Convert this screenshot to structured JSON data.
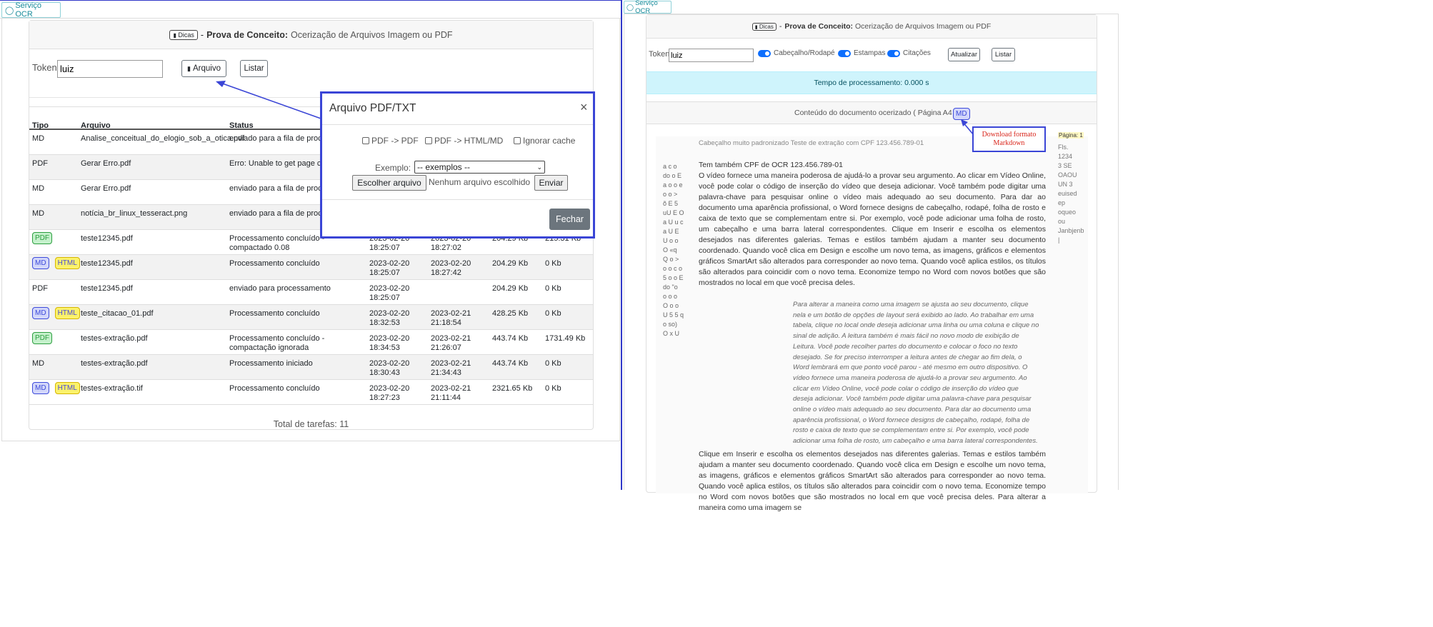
{
  "left": {
    "service_tab": "Serviço OCR",
    "header": {
      "dicas_label": "Dicas",
      "separator": "-",
      "title_bold": "Prova de Conceito:",
      "title_rest": "Ocerização de Arquivos Imagem ou PDF"
    },
    "token_label": "Token:",
    "token_value": "luiz",
    "arquivo_button": "Arquivo",
    "listar_button": "Listar",
    "table": {
      "headers": [
        "Tipo",
        "Arquivo",
        "Status"
      ],
      "rows": [
        {
          "badges": [],
          "tipo_text": "MD",
          "arquivo": "Analise_conceitual_do_elogio_sob_a_otica.pdf",
          "status": "enviado para a fila de processamento",
          "inicio": "",
          "fim": "",
          "tamanho": "",
          "saida": ""
        },
        {
          "badges": [],
          "tipo_text": "PDF",
          "arquivo": "Gerar Erro.pdf",
          "status": "Erro: Unable to get page count",
          "inicio": "",
          "fim": "",
          "tamanho": "",
          "saida": ""
        },
        {
          "badges": [],
          "tipo_text": "MD",
          "arquivo": "Gerar Erro.pdf",
          "status": "enviado para a fila de processamento",
          "inicio": "",
          "fim": "",
          "tamanho": "",
          "saida": ""
        },
        {
          "badges": [],
          "tipo_text": "MD",
          "arquivo": "notícia_br_linux_tesseract.png",
          "status": "enviado para a fila de processamento",
          "inicio": "",
          "fim": "",
          "tamanho": "",
          "saida": ""
        },
        {
          "badges": [
            "PDF"
          ],
          "tipo_text": "",
          "arquivo": "teste12345.pdf",
          "status": "Processamento concluído - compactado 0.08",
          "inicio": "2023-02-20 18:25:07",
          "fim": "2023-02-20 18:27:02",
          "tamanho": "204.29 Kb",
          "saida": "215.31 Kb"
        },
        {
          "badges": [
            "MD",
            "HTML"
          ],
          "tipo_text": "",
          "arquivo": "teste12345.pdf",
          "status": "Processamento concluído",
          "inicio": "2023-02-20 18:25:07",
          "fim": "2023-02-20 18:27:42",
          "tamanho": "204.29 Kb",
          "saida": "0 Kb"
        },
        {
          "badges": [],
          "tipo_text": "PDF",
          "arquivo": "teste12345.pdf",
          "status": "enviado para processamento",
          "inicio": "2023-02-20 18:25:07",
          "fim": "",
          "tamanho": "204.29 Kb",
          "saida": "0 Kb"
        },
        {
          "badges": [
            "MD",
            "HTML"
          ],
          "tipo_text": "",
          "arquivo": "teste_citacao_01.pdf",
          "status": "Processamento concluído",
          "inicio": "2023-02-20 18:32:53",
          "fim": "2023-02-21 21:18:54",
          "tamanho": "428.25 Kb",
          "saida": "0 Kb"
        },
        {
          "badges": [
            "PDF"
          ],
          "tipo_text": "",
          "arquivo": "testes-extração.pdf",
          "status": "Processamento concluído - compactação ignorada",
          "inicio": "2023-02-20 18:34:53",
          "fim": "2023-02-21 21:26:07",
          "tamanho": "443.74 Kb",
          "saida": "1731.49 Kb"
        },
        {
          "badges": [],
          "tipo_text": "MD",
          "arquivo": "testes-extração.pdf",
          "status": "Processamento iniciado",
          "inicio": "2023-02-20 18:30:43",
          "fim": "2023-02-21 21:34:43",
          "tamanho": "443.74 Kb",
          "saida": "0 Kb"
        },
        {
          "badges": [
            "MD",
            "HTML"
          ],
          "tipo_text": "",
          "arquivo": "testes-extração.tif",
          "status": "Processamento concluído",
          "inicio": "2023-02-20 18:27:23",
          "fim": "2023-02-21 21:11:44",
          "tamanho": "2321.65 Kb",
          "saida": "0 Kb"
        }
      ]
    },
    "total": "Total de tarefas: 11",
    "modal": {
      "title": "Arquivo PDF/TXT",
      "close": "×",
      "options": [
        "PDF -> PDF",
        "PDF -> HTML/MD",
        "Ignorar cache"
      ],
      "exemplo_label": "Exemplo:",
      "exemplo_selected": "-- exemplos --",
      "choose_button": "Escolher arquivo",
      "no_file": "Nenhum arquivo escolhido",
      "enviar_button": "Enviar",
      "fechar_button": "Fechar"
    }
  },
  "right": {
    "service_tab": "Serviço OCR",
    "header": {
      "dicas_label": "Dicas",
      "separator": "-",
      "title_bold": "Prova de Conceito:",
      "title_rest": "Ocerização de Arquivos Imagem ou PDF"
    },
    "token_label": "Token:",
    "token_value": "luiz",
    "toggles": [
      "Cabeçalho/Rodapé",
      "Estampas",
      "Citações"
    ],
    "atualizar_button": "Atualizar",
    "listar_button": "Listar",
    "processing_time": "Tempo de processamento: 0.000 s",
    "content_title": "Conteúdo do documento ocerizado ( Página A4 )",
    "md_badge": "MD",
    "annotation": "Download formato Markdown",
    "doc": {
      "header_line": "Cabeçalho muito padronizado Teste de extração com CPF 123.456.789-01",
      "page_label": "Página: 1",
      "right_margin": [
        "Fls.",
        "1234",
        "3 SE",
        "OAOU",
        "UN 3",
        "euised",
        "ep",
        "oqueo",
        "ou",
        "Janbjenb",
        "|"
      ],
      "left_margin": [
        "a c o",
        "do o E",
        "a o o e",
        "o o >",
        "õ E 5",
        "uU E O",
        "a U u c",
        "a U E",
        "U o o",
        "O «q",
        "Q o >",
        "o o c o",
        "5 o o E",
        "do \"o",
        "o o o",
        "O o o",
        "U 5 5 q",
        "o so)",
        "O x U"
      ],
      "cpf_line": "Tem também CPF de OCR 123.456.789-01",
      "paragraph1": "O vídeo fornece uma maneira poderosa de ajudá-lo a provar seu argumento. Ao clicar em Vídeo Online, você pode colar o código de inserção do vídeo que deseja adicionar. Você também pode digitar uma palavra-chave para pesquisar online o vídeo mais adequado ao seu documento. Para dar ao documento uma aparência profissional, o Word fornece designs de cabeçalho, rodapé, folha de rosto e caixa de texto que se complementam entre si. Por exemplo, você pode adicionar uma folha de rosto, um cabeçalho e uma barra lateral correspondentes. Clique em Inserir e escolha os elementos desejados nas diferentes galerias. Temas e estilos também ajudam a manter seu documento coordenado. Quando você clica em Design e escolhe um novo tema, as imagens, gráficos e elementos gráficos SmartArt são alterados para corresponder ao novo tema. Quando você aplica estilos, os títulos são alterados para coincidir com o novo tema. Economize tempo no Word com novos botões que são mostrados no local em que você precisa deles.",
      "quote": "Para alterar a maneira como uma imagem se ajusta ao seu documento, clique nela e um botão de opções de layout será exibido ao lado. Ao trabalhar em uma tabela, clique no local onde deseja adicionar uma linha ou uma coluna e clique no sinal de adição. A leitura também é mais fácil no novo modo de exibição de Leitura. Você pode recolher partes do documento e colocar o foco no texto desejado. Se for preciso interromper a leitura antes de chegar ao fim dela, o Word lembrará em que ponto você parou - até mesmo em outro dispositivo. O vídeo fornece uma maneira poderosa de ajudá-lo a provar seu argumento. Ao clicar em Vídeo Online, você pode colar o código de inserção do vídeo que deseja adicionar. Você também pode digitar uma palavra-chave para pesquisar online o vídeo mais adequado ao seu documento. Para dar ao documento uma aparência profissional, o Word fornece designs de cabeçalho, rodapé, folha de rosto e caixa de texto que se complementam entre si. Por exemplo, você pode adicionar uma folha de rosto, um cabeçalho e uma barra lateral correspondentes.",
      "paragraph2": "Clique em Inserir e escolha os elementos desejados nas diferentes galerias. Temas e estilos também ajudam a manter seu documento coordenado. Quando você clica em Design e escolhe um novo tema, as imagens, gráficos e elementos gráficos SmartArt são alterados para corresponder ao novo tema. Quando você aplica estilos, os títulos são alterados para coincidir com o novo tema. Economize tempo no Word com novos botões que são mostrados no local em que você precisa deles. Para alterar a maneira como uma imagem se"
    }
  },
  "colors": {
    "frame_border": "#3038c9",
    "callout_blue": "#3a45d6",
    "annotation_red": "#d9261c",
    "info_bg": "#cff4fc",
    "toggle_blue": "#0d6efd",
    "fechar_bg": "#6c757d"
  }
}
